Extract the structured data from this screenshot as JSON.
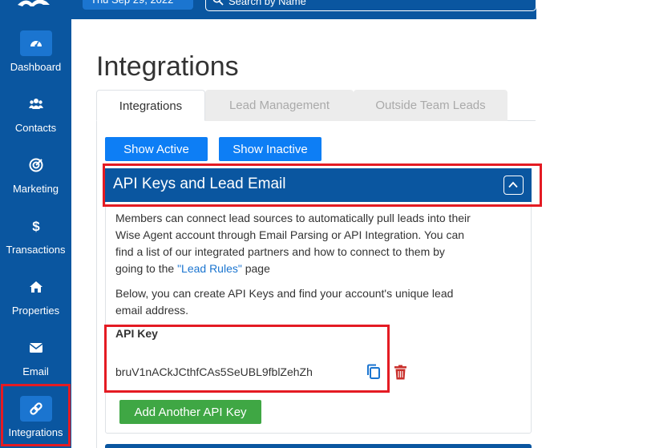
{
  "topbar": {
    "date": "Thu Sep 29, 2022",
    "search_placeholder": "Search by Name"
  },
  "sidebar": {
    "items": [
      {
        "label": "Dashboard",
        "icon": "dashboard-icon"
      },
      {
        "label": "Contacts",
        "icon": "contacts-icon"
      },
      {
        "label": "Marketing",
        "icon": "target-icon"
      },
      {
        "label": "Transactions",
        "icon": "dollar-icon"
      },
      {
        "label": "Properties",
        "icon": "home-icon"
      },
      {
        "label": "Email",
        "icon": "envelope-icon"
      },
      {
        "label": "Integrations",
        "icon": "link-icon",
        "active": true
      }
    ]
  },
  "page": {
    "title": "Integrations"
  },
  "tabs": [
    {
      "label": "Integrations",
      "active": true
    },
    {
      "label": "Lead Management"
    },
    {
      "label": "Outside Team Leads"
    }
  ],
  "filters": {
    "show_active": "Show Active",
    "show_inactive": "Show Inactive"
  },
  "panel": {
    "title": "API Keys and Lead Email",
    "paragraph1": {
      "line1": "Members can connect lead sources to automatically pull leads into their",
      "line2": "Wise Agent account through Email Parsing or API Integration. You can",
      "line3": "find a list of our integrated partners and how to connect to them by",
      "line4_before": "going to the ",
      "line4_link": "\"Lead Rules\"",
      "line4_after": " page"
    },
    "paragraph2": {
      "line1": "Below, you can create API Keys and find your account's unique lead",
      "line2": "email address."
    },
    "api_key_label": "API Key",
    "api_key_value": "bruV1nACkJCthfCAs5SeUBL9fblZehZh",
    "add_button": "Add Another API Key"
  },
  "colors": {
    "brand_blue": "#0a56a0",
    "button_blue": "#0d7ef5",
    "highlight_red": "#e41b23",
    "button_green": "#3fa744",
    "trash_red": "#c9302c"
  }
}
